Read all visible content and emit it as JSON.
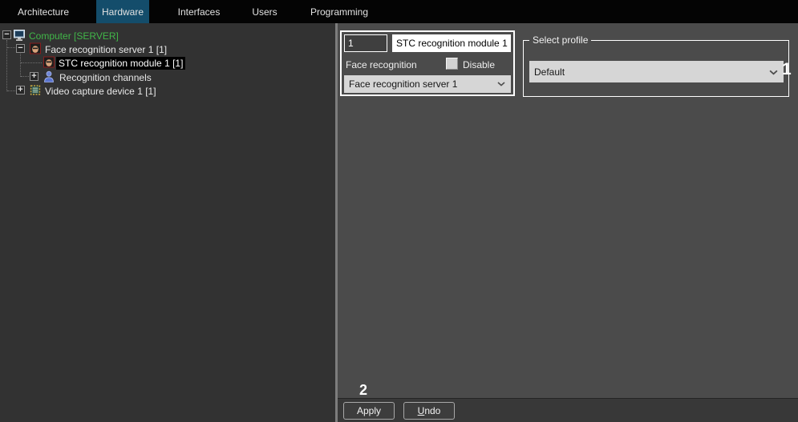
{
  "tabs": [
    {
      "label": "Architecture",
      "active": false
    },
    {
      "label": "Hardware",
      "active": true
    },
    {
      "label": "Interfaces",
      "active": false
    },
    {
      "label": "Users",
      "active": false
    },
    {
      "label": "Programming",
      "active": false
    }
  ],
  "tree": {
    "nodes": [
      {
        "label": "Computer [SERVER]",
        "expander": "−",
        "icon": "monitor-icon",
        "selected": false,
        "text_color": "#41b649"
      },
      {
        "label": "Face recognition server 1 [1]",
        "expander": "−",
        "icon": "face-icon",
        "selected": false
      },
      {
        "label": "STC recognition module 1 [1]",
        "expander": "",
        "icon": "face-icon",
        "selected": true
      },
      {
        "label": "Recognition channels",
        "expander": "+",
        "icon": "person-icon",
        "selected": false
      },
      {
        "label": "Video capture device 1 [1]",
        "expander": "+",
        "icon": "chip-icon",
        "selected": false
      }
    ]
  },
  "editor": {
    "id_value": "1",
    "name_value": "STC recognition module 1",
    "type_label": "Face recognition",
    "disable_label": "Disable",
    "disable_checked": false,
    "parent_select_value": "Face recognition server 1"
  },
  "profile": {
    "group_label": "Select profile",
    "select_value": "Default",
    "annotation": "1"
  },
  "footer": {
    "annotation": "2",
    "apply_label": "Apply",
    "undo_label": "Undo"
  },
  "colors": {
    "active_tab": "#144d6b",
    "computer_node_green": "#41b649",
    "selection_bg": "#000000",
    "left_panel_bg": "#323232",
    "right_panel_bg": "#4b4b4b",
    "group_border": "#ffffff"
  }
}
